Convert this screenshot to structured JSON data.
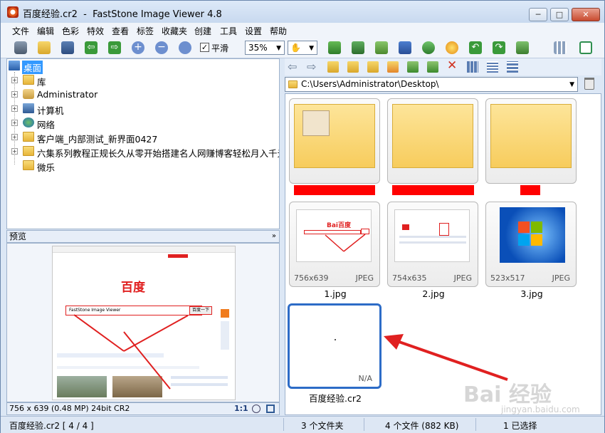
{
  "window": {
    "title": "百度经验.cr2  -  FastStone Image Viewer 4.8",
    "minimize": "─",
    "maximize": "□",
    "close": "✕"
  },
  "menu": [
    "文件",
    "编辑",
    "色彩",
    "特效",
    "查看",
    "标签",
    "收藏夹",
    "创建",
    "工具",
    "设置",
    "帮助"
  ],
  "toolbar": {
    "smooth_checked": true,
    "smooth_label": "平滑",
    "zoom_value": "35%",
    "hand_icon": "hand-icon",
    "icons": [
      "camera-icon",
      "open-folder-icon",
      "save-icon",
      "prev-icon",
      "next-icon",
      "zoom-in-icon",
      "zoom-out-icon",
      "fit-icon",
      "slideshow-icon",
      "resize-icon",
      "crop-icon",
      "color-icon",
      "stamp-icon",
      "effects-icon",
      "rotate-left-icon",
      "rotate-right-icon",
      "compare-icon",
      "layout-icon",
      "fullscreen-icon"
    ]
  },
  "tree": {
    "items": [
      {
        "label": "桌面",
        "selected": true
      },
      {
        "label": "库"
      },
      {
        "label": "Administrator"
      },
      {
        "label": "计算机"
      },
      {
        "label": "网络"
      },
      {
        "label": "客户端_内部测试_新界面0427"
      },
      {
        "label": "六集系列教程正规长久从零开始搭建名人网赚博客轻松月入千元"
      },
      {
        "label": "微乐"
      }
    ]
  },
  "preview": {
    "title": "预览",
    "collapse": "»",
    "info": "756 x 639 (0.48 MP)  24bit  CR2",
    "ratio": "1:1",
    "baidu_text": "百度",
    "search_text": "FastStone Image Viewer",
    "search_button": "百度一下"
  },
  "browser": {
    "path": "C:\\Users\\Administrator\\Desktop\\",
    "thumbs": [
      {
        "kind": "folder",
        "caption": "",
        "redacted": true
      },
      {
        "kind": "folder",
        "caption": "",
        "redacted": true
      },
      {
        "kind": "folder",
        "caption": "",
        "redacted": true
      },
      {
        "kind": "image",
        "dims": "756x639",
        "type": "JPEG",
        "caption": "1.jpg"
      },
      {
        "kind": "image",
        "dims": "754x635",
        "type": "JPEG",
        "caption": "2.jpg"
      },
      {
        "kind": "image",
        "dims": "523x517",
        "type": "JPEG",
        "caption": "3.jpg"
      },
      {
        "kind": "raw",
        "dims": "",
        "type": "N/A",
        "caption": "百度经验.cr2",
        "selected": true
      }
    ]
  },
  "status": {
    "file": "百度经验.cr2 [ 4 / 4 ]",
    "folders": "3 个文件夹",
    "files": "4 个文件 (882 KB)",
    "selected": "1 已选择"
  },
  "watermark": {
    "main": "Bai 经验",
    "sub": "jingyan.baidu.com"
  },
  "colors": {
    "accent": "#2d6cc7",
    "annotation": "#e02020",
    "selection": "#3399ff"
  }
}
